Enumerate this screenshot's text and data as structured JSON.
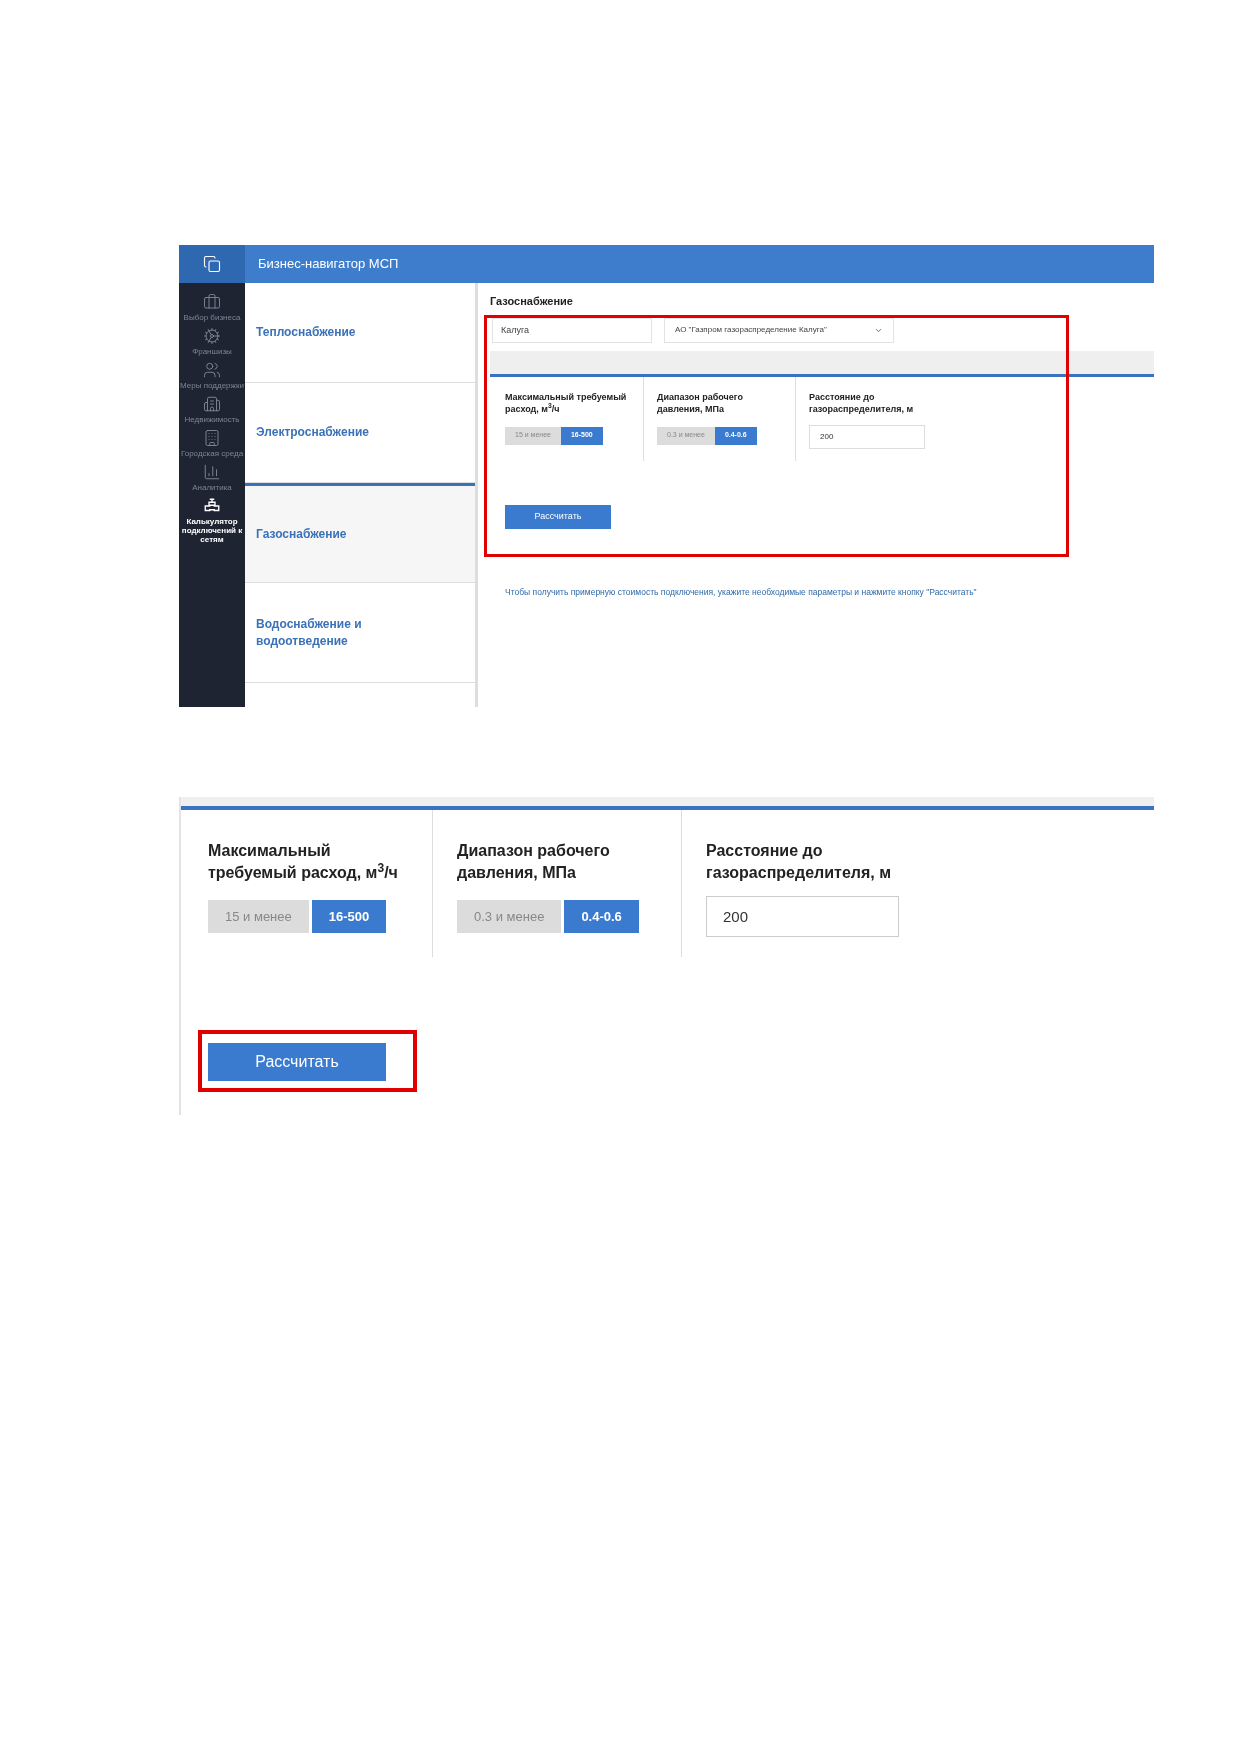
{
  "app_screenshot": {
    "header_title": "Бизнес-навигатор МСП",
    "sidebar": [
      {
        "label": "Выбор бизнеса",
        "kind": "briefcase",
        "selected": false
      },
      {
        "label": "Франшизы",
        "kind": "gear",
        "selected": false
      },
      {
        "label": "Меры поддержки",
        "kind": "people",
        "selected": false
      },
      {
        "label": "Недвижимость",
        "kind": "building",
        "selected": false
      },
      {
        "label": "Городская среда",
        "kind": "city",
        "selected": false
      },
      {
        "label": "Аналитика",
        "kind": "chart",
        "selected": false
      },
      {
        "label": "Калькулятор подключений к сетям",
        "kind": "valve",
        "selected": true
      }
    ],
    "categories": [
      {
        "label": "Теплоснабжение",
        "selected": false
      },
      {
        "label": "Электроснабжение",
        "selected": false
      },
      {
        "label": "Газоснабжение",
        "selected": true
      },
      {
        "label": "Водоснабжение и водоотведение",
        "selected": false
      }
    ],
    "section_title": "Газоснабжение",
    "region_field": {
      "value": "Калуга"
    },
    "supplier_select": {
      "value": "АО \"Газпром газораспределение Калуга\""
    },
    "params": [
      {
        "kind": "toggle",
        "label": "Максимальный требуемый расход, м$^{3}$/ч",
        "options": [
          {
            "label": "15 и менее",
            "selected": false
          },
          {
            "label": "16-500",
            "selected": true
          }
        ]
      },
      {
        "kind": "toggle",
        "label": "Диапазон рабочего давления, МПа",
        "options": [
          {
            "label": "0.3 и менее",
            "selected": false
          },
          {
            "label": "0.4-0.6",
            "selected": true
          }
        ]
      },
      {
        "kind": "input",
        "label": "Расстояние до газораспределителя, м",
        "value": "200"
      }
    ],
    "calculate_button": "Рассчитать",
    "hint": "Чтобы получить примерную стоимость подключения, укажите необходимые параметры и нажмите кнопку \"Рассчитать\""
  },
  "zoomed_form": {
    "params": [
      {
        "kind": "toggle",
        "label": "Максимальный требуемый расход, м$^{3}$/ч",
        "options": [
          {
            "label": "15 и менее",
            "selected": false
          },
          {
            "label": "16-500",
            "selected": true
          }
        ]
      },
      {
        "kind": "toggle",
        "label": "Диапазон рабочего давления, МПа",
        "options": [
          {
            "label": "0.3 и менее",
            "selected": false
          },
          {
            "label": "0.4-0.6",
            "selected": true
          }
        ]
      },
      {
        "kind": "input",
        "label": "Расстояние до газораспределителя, м",
        "value": "200"
      }
    ],
    "calculate_button": "Рассчитать"
  }
}
